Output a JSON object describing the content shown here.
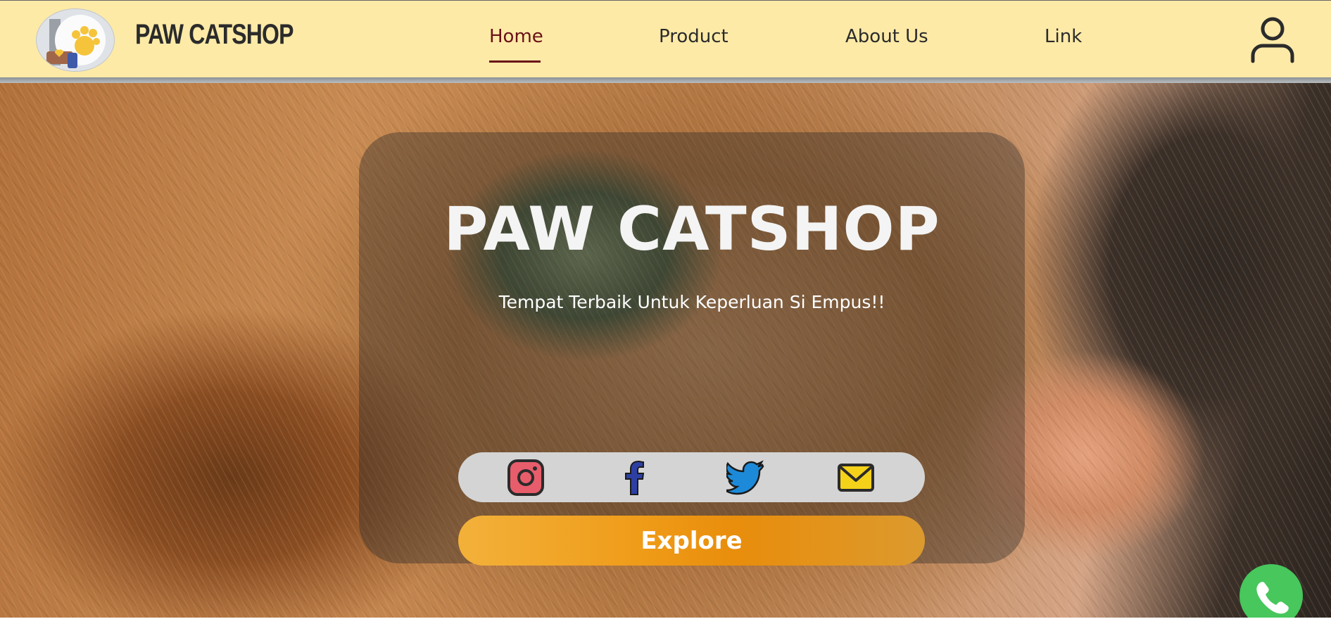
{
  "brand": {
    "name": "PAW CATSHOP",
    "logo_icon": "cat-paw-logo"
  },
  "nav": {
    "items": [
      {
        "label": "Home",
        "active": true
      },
      {
        "label": "Product",
        "active": false
      },
      {
        "label": "About Us",
        "active": false
      },
      {
        "label": "Link",
        "active": false
      }
    ],
    "user_icon": "user-account-icon"
  },
  "hero": {
    "title": "PAW CATSHOP",
    "subtitle": "Tempat Terbaik Untuk Keperluan Si Empus!!",
    "social": [
      {
        "icon": "instagram-icon",
        "color": "#e85d6b"
      },
      {
        "icon": "facebook-icon",
        "color": "#2d3fa3"
      },
      {
        "icon": "twitter-icon",
        "color": "#1d8ad9"
      },
      {
        "icon": "email-icon",
        "color": "#f5d21a"
      }
    ],
    "button_label": "Explore"
  },
  "floating": {
    "whatsapp_icon": "whatsapp-phone-icon",
    "color": "#47c75c"
  },
  "colors": {
    "navbar_bg": "#fdeaa7",
    "active_link": "#6a1016",
    "accent": "#ef9b18"
  }
}
